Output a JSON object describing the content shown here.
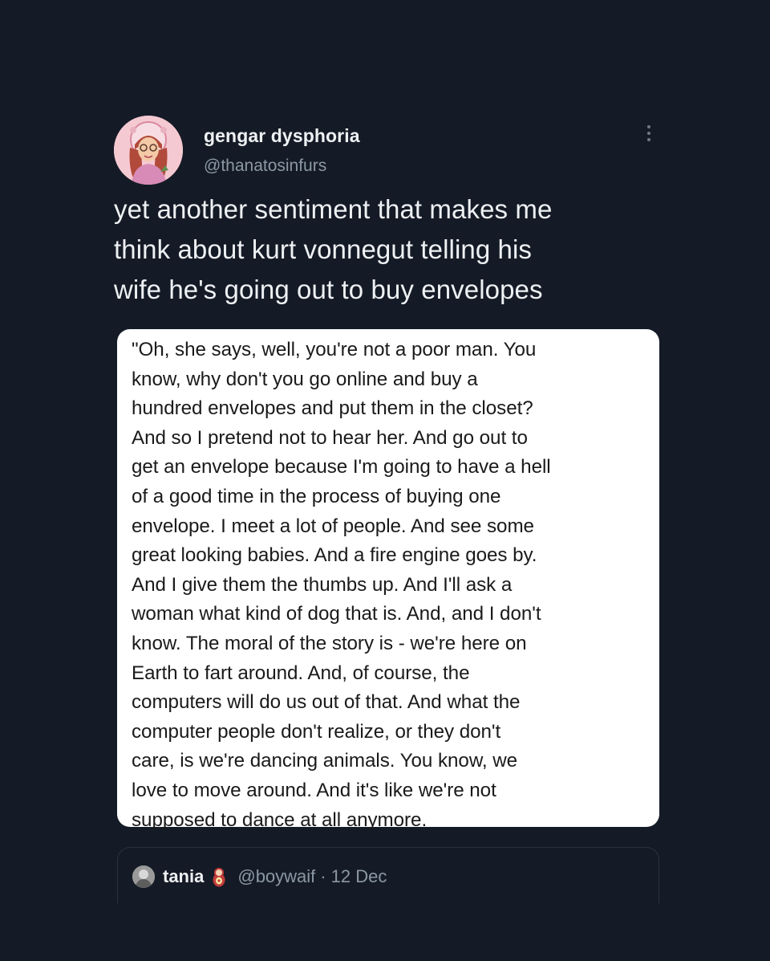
{
  "tweet": {
    "display_name": "gengar dysphoria",
    "handle": "@thanatosinfurs",
    "text": "yet another sentiment that makes me\nthink about kurt vonnegut telling his\nwife he's going out to buy envelopes",
    "more_icon": "more-vertical-icon"
  },
  "quote_image": {
    "text": "\"Oh, she says, well, you're not a poor man. You\nknow, why don't you go online and buy a\nhundred envelopes and put them in the closet?\nAnd so I pretend not to hear her. And go out to\nget an envelope because I'm going to have a hell\nof a good time in the process of buying one\nenvelope. I meet a lot of people. And see some\ngreat looking babies. And a fire engine goes by.\nAnd I give them the thumbs up. And I'll ask a\nwoman what kind of dog that is. And, and I don't\nknow. The moral of the story is - we're here on\nEarth to fart around. And, of course, the\ncomputers will do us out of that. And what the\ncomputer people don't realize, or they don't\ncare, is we're dancing animals. You know, we\nlove to move around. And it's like we're not\nsupposed to dance at all anymore."
  },
  "quoted_tweet": {
    "display_name": "tania",
    "emoji_icon": "nesting-doll-icon",
    "handle": "@boywaif",
    "separator": "·",
    "date": "12 Dec"
  },
  "colors": {
    "background": "#151b26",
    "text_primary": "#eef1f3",
    "text_secondary": "#8b98a5",
    "card_background": "#ffffff"
  }
}
